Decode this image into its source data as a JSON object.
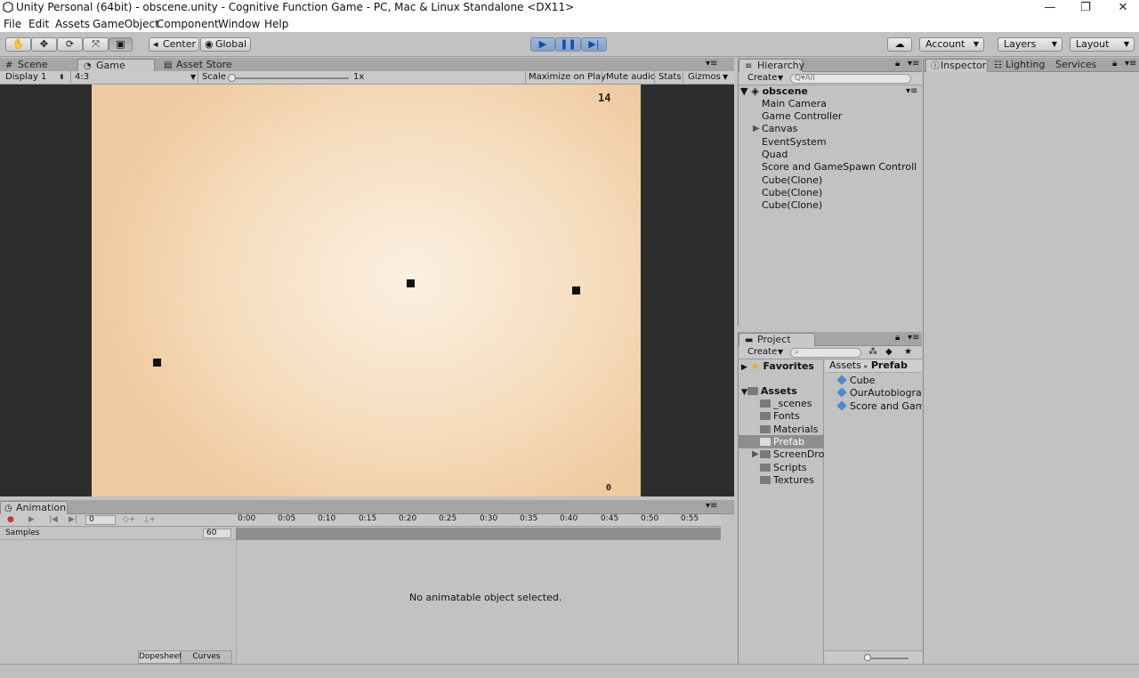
{
  "window": {
    "title": "Unity Personal (64bit) - obscene.unity - Cognitive Function Game - PC, Mac & Linux Standalone <DX11>",
    "controls": [
      "—",
      "❐",
      "✕"
    ]
  },
  "menu": [
    "File",
    "Edit",
    "Assets",
    "GameObject",
    "Component",
    "Window",
    "Help"
  ],
  "toolbar": {
    "pivot": "Center",
    "space": "Global",
    "account": "Account",
    "layers": "Layers",
    "layout": "Layout"
  },
  "scene_tabs": {
    "scene": "Scene",
    "game": "Game",
    "asset_store": "Asset Store"
  },
  "game_bar": {
    "display": "Display 1",
    "aspect": "4:3",
    "scale_label": "Scale",
    "scale_value": "1x",
    "maximize": "Maximize on Play",
    "mute": "Mute audio",
    "stats": "Stats",
    "gizmos": "Gizmos"
  },
  "game_view": {
    "score_top": "14",
    "score_bottom": "0",
    "accent_bg": "#f6dcbc"
  },
  "hierarchy": {
    "tab": "Hierarchy",
    "create": "Create",
    "search_placeholder": "Q▾All",
    "scene_name": "obscene",
    "items": [
      "Main Camera",
      "Game Controller",
      "Canvas",
      "EventSystem",
      "Quad",
      "Score and GameSpawn Controll",
      "Cube(Clone)",
      "Cube(Clone)",
      "Cube(Clone)"
    ]
  },
  "project": {
    "tab": "Project",
    "create": "Create",
    "favorites": "Favorites",
    "assets": "Assets",
    "folders": [
      "_scenes",
      "Fonts",
      "Materials",
      "Prefab",
      "ScreenDrop",
      "Scripts",
      "Textures"
    ],
    "breadcrumb_root": "Assets",
    "breadcrumb_current": "Prefab",
    "files": [
      "Cube",
      "OurAutobiograp",
      "Score and Gam"
    ]
  },
  "inspector": {
    "tab": "Inspector",
    "lighting": "Lighting",
    "services": "Services"
  },
  "animation": {
    "tab": "Animation",
    "frame": "0",
    "samples_label": "Samples",
    "samples_value": "60",
    "timeline": [
      "0:00",
      "0:05",
      "0:10",
      "0:15",
      "0:20",
      "0:25",
      "0:30",
      "0:35",
      "0:40",
      "0:45",
      "0:50",
      "0:55"
    ],
    "empty_message": "No animatable object selected.",
    "dopesheet": "Dopesheet",
    "curves": "Curves"
  }
}
